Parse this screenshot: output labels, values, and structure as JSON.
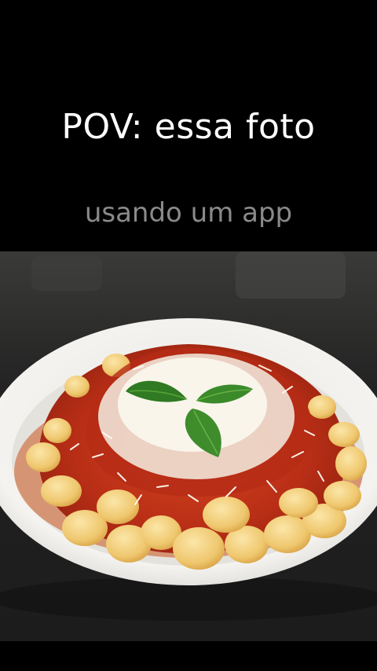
{
  "overlay": {
    "headline": "POV: essa foto",
    "subtitle": "usando um app"
  },
  "photo": {
    "subject": "gnocchi-with-tomato-sauce-and-parmesan",
    "colors": {
      "sauce": "#c0321c",
      "gnocchi": "#f2cf7e",
      "cheese": "#f4efe2",
      "basil": "#3e8a2a",
      "plate": "#f1f1ef",
      "table": "#2b2b2b"
    }
  }
}
